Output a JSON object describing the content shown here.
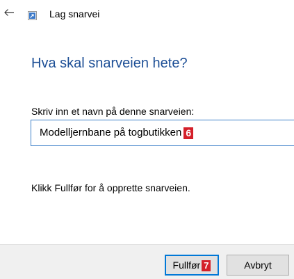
{
  "window": {
    "title": "Lag snarvei",
    "back_icon": "arrow-left-icon",
    "app_icon": "shortcut-icon"
  },
  "main": {
    "heading": "Hva skal snarveien hete?",
    "field_label": "Skriv inn et navn på denne snarveien:",
    "name_value": "Modelljernbane på togbutikken",
    "instruction": "Klikk Fullfør for å opprette snarveien."
  },
  "footer": {
    "finish_label": "Fullfør",
    "cancel_label": "Avbryt"
  },
  "markers": {
    "input_marker": "6",
    "finish_marker": "7"
  },
  "colors": {
    "heading": "#1d4f96",
    "input_border": "#3c7fc8",
    "marker_bg": "#d4202a",
    "default_button_border": "#0078d7",
    "footer_bg": "#f0f0f0"
  }
}
